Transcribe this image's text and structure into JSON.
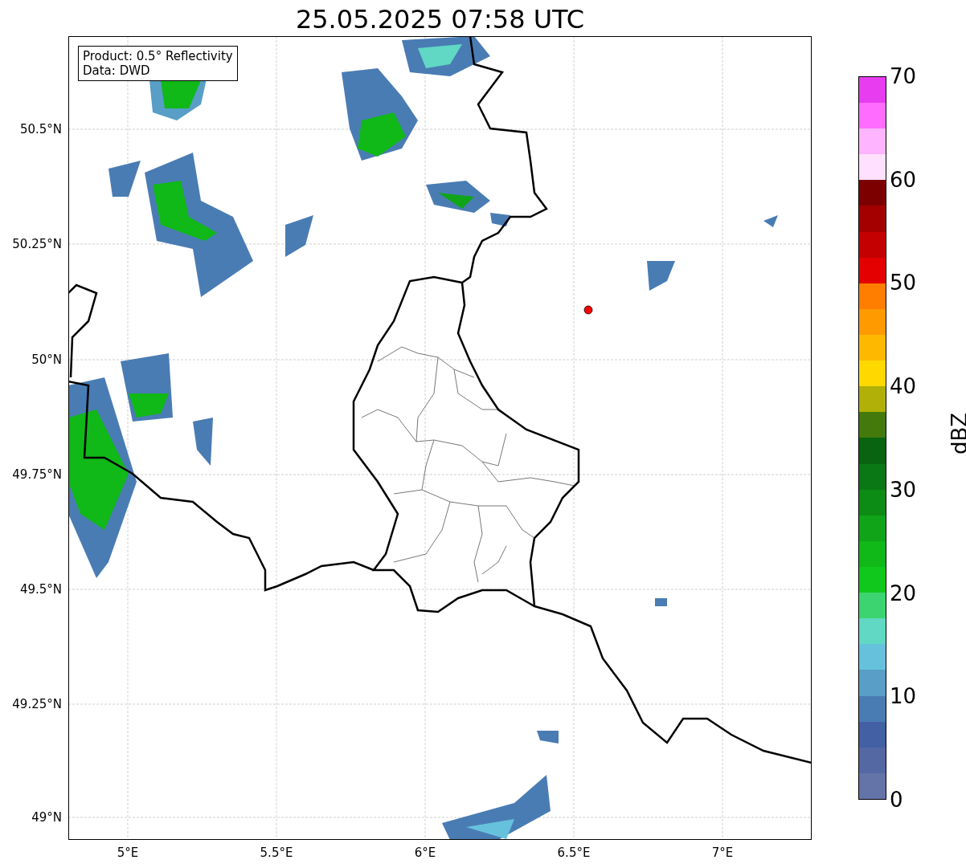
{
  "title": "25.05.2025 07:58 UTC",
  "legend": [
    "Product: 0.5° Reflectivity",
    "Data: DWD"
  ],
  "y_ticks": [
    "50.5°N",
    "50.25°N",
    "50°N",
    "49.75°N",
    "49.5°N",
    "49.25°N",
    "49°N"
  ],
  "x_ticks": [
    "5°E",
    "5.5°E",
    "6°E",
    "6.5°E",
    "7°E"
  ],
  "colorbar": {
    "label": "dBZ",
    "ticks": [
      "70",
      "60",
      "50",
      "40",
      "30",
      "20",
      "10",
      "0"
    ],
    "bands": [
      {
        "color": "#6474a8"
      },
      {
        "color": "#5468a4"
      },
      {
        "color": "#4360a4"
      },
      {
        "color": "#4a7cb4"
      },
      {
        "color": "#589ec6"
      },
      {
        "color": "#66c2dc"
      },
      {
        "color": "#60d8c4"
      },
      {
        "color": "#3cd470"
      },
      {
        "color": "#10c81c"
      },
      {
        "color": "#10b818"
      },
      {
        "color": "#10a418"
      },
      {
        "color": "#0c8c14"
      },
      {
        "color": "#0a7814"
      },
      {
        "color": "#086410"
      },
      {
        "color": "#447a0c"
      },
      {
        "color": "#b0b008"
      },
      {
        "color": "#ffd800"
      },
      {
        "color": "#ffb800"
      },
      {
        "color": "#ff9a00"
      },
      {
        "color": "#ff7e00"
      },
      {
        "color": "#e40000"
      },
      {
        "color": "#c40000"
      },
      {
        "color": "#a40000"
      },
      {
        "color": "#7c0000"
      },
      {
        "color": "#ffe0ff"
      },
      {
        "color": "#ffb4ff"
      },
      {
        "color": "#ff6cff"
      },
      {
        "color": "#e83cf0"
      }
    ]
  }
}
